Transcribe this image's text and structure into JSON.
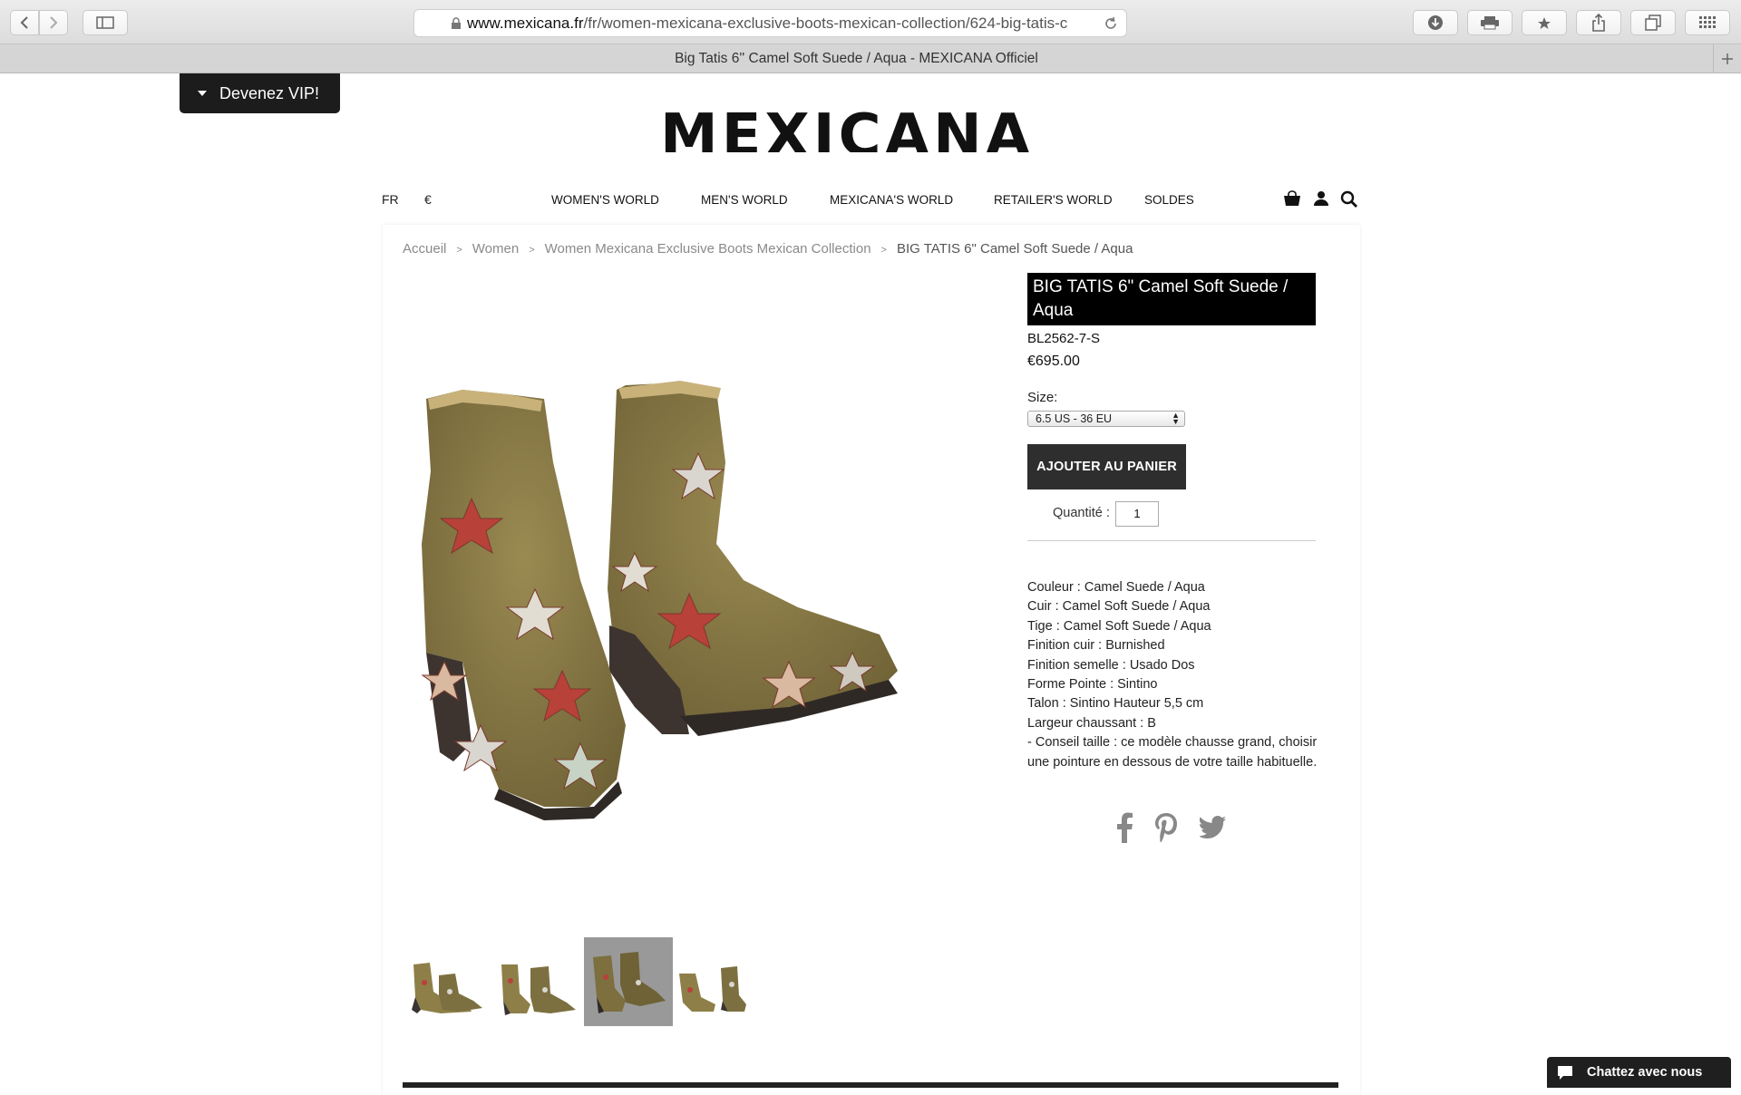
{
  "browser": {
    "url_domain": "www.mexicana.fr",
    "url_path": "/fr/women-mexicana-exclusive-boots-mexican-collection/624-big-tatis-c",
    "tab_title": "Big Tatis 6'' Camel Soft Suede / Aqua - MEXICANA Officiel"
  },
  "vip": {
    "label": "Devenez VIP!"
  },
  "logo": {
    "text": "MEXICANA"
  },
  "nav": {
    "lang": "FR",
    "currency": "€",
    "items": [
      {
        "label": "WOMEN'S WORLD"
      },
      {
        "label": "MEN'S WORLD"
      },
      {
        "label": "MEXICANA'S WORLD"
      },
      {
        "label": "RETAILER'S WORLD"
      },
      {
        "label": "SOLDES"
      }
    ]
  },
  "breadcrumb": {
    "items": [
      "Accueil",
      "Women",
      "Women Mexicana Exclusive Boots Mexican Collection"
    ],
    "separator": ">",
    "current": "BIG TATIS 6\" Camel Soft Suede / Aqua"
  },
  "product": {
    "title": "BIG TATIS 6\" Camel Soft Suede / Aqua",
    "sku": "BL2562-7-S",
    "price": "€695.00",
    "size_label": "Size:",
    "size_selected": "6.5 US - 36 EU",
    "add_to_cart": "AJOUTER AU PANIER",
    "quantity_label": "Quantité :",
    "quantity_value": "1",
    "specs": [
      "Couleur : Camel Suede / Aqua",
      "Cuir : Camel Soft Suede / Aqua",
      "Tige : Camel Soft Suede / Aqua",
      "Finition cuir : Burnished",
      "Finition semelle : Usado Dos",
      "Forme Pointe : Sintino",
      "Talon : Sintino Hauteur 5,5 cm",
      "Largeur chaussant : B",
      "- Conseil taille : ce modèle chausse grand, choisir une pointure en dessous de votre taille habituelle."
    ],
    "thumbnails_active_index": 2
  },
  "social": [
    "facebook-icon",
    "pinterest-icon",
    "twitter-icon"
  ],
  "chat": {
    "label": "Chattez avec nous"
  },
  "colors": {
    "suede": "#8a7a45",
    "star_red": "#b8413a",
    "star_silver": "#d9d6cf",
    "sole": "#3a3330",
    "dark": "#1c1c1c"
  }
}
